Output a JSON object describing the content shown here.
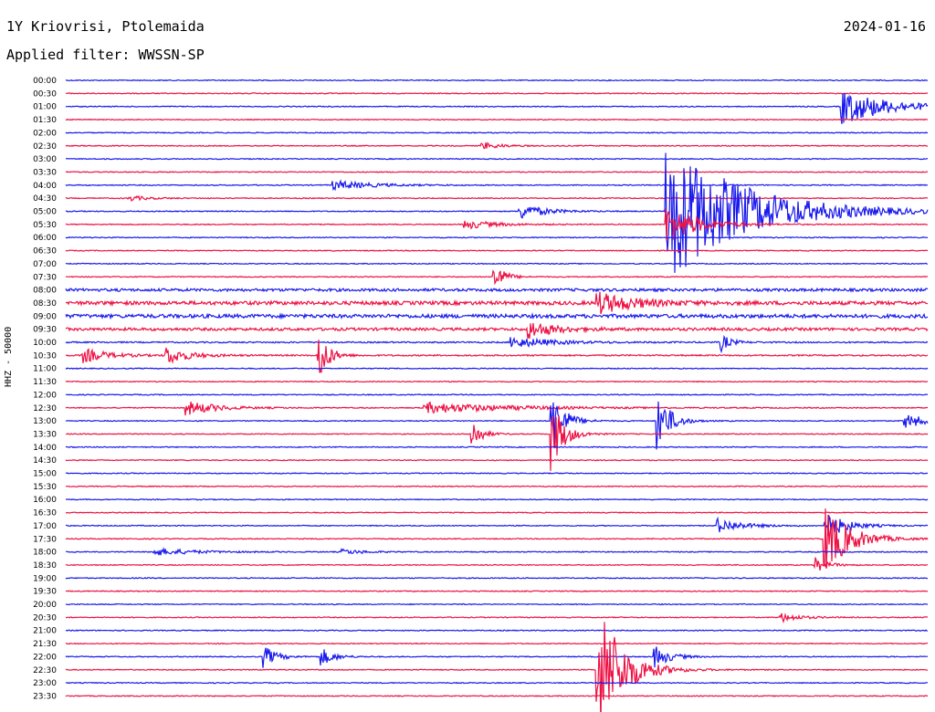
{
  "header": {
    "station": "1Y Kriovrisi, Ptolemaida",
    "date": "2024-01-16",
    "filter_label": "Applied filter:",
    "filter_value": "WWSSN-SP"
  },
  "channel_label": "HHZ - 50000",
  "colors": {
    "blue": "#1a1aee",
    "red": "#ee1144"
  },
  "chart_data": {
    "type": "line",
    "title": "1Y Kriovrisi, Ptolemaida",
    "subtitle": "Applied filter: WWSSN-SP",
    "ylabel": "HHZ - 50000",
    "row_minutes": 30,
    "color_cycle": [
      "#1a1aee",
      "#ee1144"
    ],
    "time_labels": [
      "00:00",
      "00:30",
      "01:00",
      "01:30",
      "02:00",
      "02:30",
      "03:00",
      "03:30",
      "04:00",
      "04:30",
      "05:00",
      "05:30",
      "06:00",
      "06:30",
      "07:00",
      "07:30",
      "08:00",
      "08:30",
      "09:00",
      "09:30",
      "10:00",
      "10:30",
      "11:00",
      "11:30",
      "12:00",
      "12:30",
      "13:00",
      "13:30",
      "14:00",
      "14:30",
      "15:00",
      "15:30",
      "16:00",
      "16:30",
      "17:00",
      "17:30",
      "18:00",
      "18:30",
      "19:00",
      "19:30",
      "20:00",
      "20:30",
      "21:00",
      "21:30",
      "22:00",
      "22:30",
      "23:00",
      "23:30"
    ],
    "noise_levels": [
      1,
      1,
      1,
      1,
      1,
      1,
      1,
      1,
      1,
      1,
      1,
      1,
      1,
      1,
      1,
      1,
      3,
      4,
      4,
      3,
      1.5,
      1.5,
      1,
      1,
      1,
      1,
      1,
      1,
      1,
      1,
      1,
      1,
      1,
      1,
      1,
      1,
      1,
      1,
      1,
      1,
      1,
      1,
      1,
      1,
      1,
      1,
      1,
      1
    ],
    "events": [
      {
        "row": 2,
        "minute": 27,
        "amp": 20,
        "dur": 1.5
      },
      {
        "row": 5,
        "minute": 14.5,
        "amp": 4,
        "dur": 0.6
      },
      {
        "row": 8,
        "minute": 9.3,
        "amp": 5,
        "dur": 1.3
      },
      {
        "row": 9,
        "minute": 2.2,
        "amp": 3,
        "dur": 0.6
      },
      {
        "row": 10,
        "minute": 15.8,
        "amp": 9,
        "dur": 0.8
      },
      {
        "row": 10,
        "minute": 20.9,
        "amp": 80,
        "dur": 2.5
      },
      {
        "row": 11,
        "minute": 13.9,
        "amp": 5,
        "dur": 1.0
      },
      {
        "row": 11,
        "minute": 20.9,
        "amp": 22,
        "dur": 1.0
      },
      {
        "row": 15,
        "minute": 14.9,
        "amp": 20,
        "dur": 0.3
      },
      {
        "row": 17,
        "minute": 18.5,
        "amp": 12,
        "dur": 1.2
      },
      {
        "row": 19,
        "minute": 16.1,
        "amp": 10,
        "dur": 0.8
      },
      {
        "row": 20,
        "minute": 15.5,
        "amp": 6,
        "dur": 1.3
      },
      {
        "row": 20,
        "minute": 22.8,
        "amp": 10,
        "dur": 0.3
      },
      {
        "row": 21,
        "minute": 0.6,
        "amp": 8,
        "dur": 0.8
      },
      {
        "row": 21,
        "minute": 3.5,
        "amp": 10,
        "dur": 0.7
      },
      {
        "row": 21,
        "minute": 8.8,
        "amp": 35,
        "dur": 0.3
      },
      {
        "row": 25,
        "minute": 4.2,
        "amp": 8,
        "dur": 1.0
      },
      {
        "row": 25,
        "minute": 12.5,
        "amp": 6,
        "dur": 2.8
      },
      {
        "row": 26,
        "minute": 16.9,
        "amp": 40,
        "dur": 0.4
      },
      {
        "row": 26,
        "minute": 20.6,
        "amp": 35,
        "dur": 0.4
      },
      {
        "row": 26,
        "minute": 29.2,
        "amp": 8,
        "dur": 0.8
      },
      {
        "row": 27,
        "minute": 14.1,
        "amp": 20,
        "dur": 0.3
      },
      {
        "row": 27,
        "minute": 16.9,
        "amp": 40,
        "dur": 0.4
      },
      {
        "row": 34,
        "minute": 22.7,
        "amp": 8,
        "dur": 0.8
      },
      {
        "row": 34,
        "minute": 26.4,
        "amp": 15,
        "dur": 0.7
      },
      {
        "row": 35,
        "minute": 26.4,
        "amp": 40,
        "dur": 0.8
      },
      {
        "row": 36,
        "minute": 3.1,
        "amp": 4,
        "dur": 1.3
      },
      {
        "row": 36,
        "minute": 9.6,
        "amp": 3,
        "dur": 0.7
      },
      {
        "row": 37,
        "minute": 26.1,
        "amp": 8,
        "dur": 0.4
      },
      {
        "row": 41,
        "minute": 24.9,
        "amp": 5,
        "dur": 0.6
      },
      {
        "row": 44,
        "minute": 6.9,
        "amp": 12,
        "dur": 0.4
      },
      {
        "row": 44,
        "minute": 8.9,
        "amp": 10,
        "dur": 0.4
      },
      {
        "row": 44,
        "minute": 20.5,
        "amp": 12,
        "dur": 0.5
      },
      {
        "row": 45,
        "minute": 18.5,
        "amp": 80,
        "dur": 0.8
      }
    ]
  }
}
